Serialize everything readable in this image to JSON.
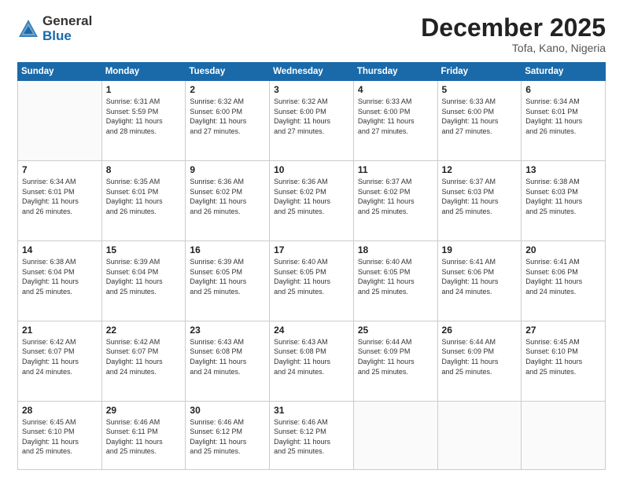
{
  "logo": {
    "general": "General",
    "blue": "Blue"
  },
  "header": {
    "month": "December 2025",
    "location": "Tofa, Kano, Nigeria"
  },
  "weekdays": [
    "Sunday",
    "Monday",
    "Tuesday",
    "Wednesday",
    "Thursday",
    "Friday",
    "Saturday"
  ],
  "weeks": [
    [
      {
        "day": "",
        "info": ""
      },
      {
        "day": "1",
        "info": "Sunrise: 6:31 AM\nSunset: 5:59 PM\nDaylight: 11 hours\nand 28 minutes."
      },
      {
        "day": "2",
        "info": "Sunrise: 6:32 AM\nSunset: 6:00 PM\nDaylight: 11 hours\nand 27 minutes."
      },
      {
        "day": "3",
        "info": "Sunrise: 6:32 AM\nSunset: 6:00 PM\nDaylight: 11 hours\nand 27 minutes."
      },
      {
        "day": "4",
        "info": "Sunrise: 6:33 AM\nSunset: 6:00 PM\nDaylight: 11 hours\nand 27 minutes."
      },
      {
        "day": "5",
        "info": "Sunrise: 6:33 AM\nSunset: 6:00 PM\nDaylight: 11 hours\nand 27 minutes."
      },
      {
        "day": "6",
        "info": "Sunrise: 6:34 AM\nSunset: 6:01 PM\nDaylight: 11 hours\nand 26 minutes."
      }
    ],
    [
      {
        "day": "7",
        "info": "Sunrise: 6:34 AM\nSunset: 6:01 PM\nDaylight: 11 hours\nand 26 minutes."
      },
      {
        "day": "8",
        "info": "Sunrise: 6:35 AM\nSunset: 6:01 PM\nDaylight: 11 hours\nand 26 minutes."
      },
      {
        "day": "9",
        "info": "Sunrise: 6:36 AM\nSunset: 6:02 PM\nDaylight: 11 hours\nand 26 minutes."
      },
      {
        "day": "10",
        "info": "Sunrise: 6:36 AM\nSunset: 6:02 PM\nDaylight: 11 hours\nand 25 minutes."
      },
      {
        "day": "11",
        "info": "Sunrise: 6:37 AM\nSunset: 6:02 PM\nDaylight: 11 hours\nand 25 minutes."
      },
      {
        "day": "12",
        "info": "Sunrise: 6:37 AM\nSunset: 6:03 PM\nDaylight: 11 hours\nand 25 minutes."
      },
      {
        "day": "13",
        "info": "Sunrise: 6:38 AM\nSunset: 6:03 PM\nDaylight: 11 hours\nand 25 minutes."
      }
    ],
    [
      {
        "day": "14",
        "info": "Sunrise: 6:38 AM\nSunset: 6:04 PM\nDaylight: 11 hours\nand 25 minutes."
      },
      {
        "day": "15",
        "info": "Sunrise: 6:39 AM\nSunset: 6:04 PM\nDaylight: 11 hours\nand 25 minutes."
      },
      {
        "day": "16",
        "info": "Sunrise: 6:39 AM\nSunset: 6:05 PM\nDaylight: 11 hours\nand 25 minutes."
      },
      {
        "day": "17",
        "info": "Sunrise: 6:40 AM\nSunset: 6:05 PM\nDaylight: 11 hours\nand 25 minutes."
      },
      {
        "day": "18",
        "info": "Sunrise: 6:40 AM\nSunset: 6:05 PM\nDaylight: 11 hours\nand 25 minutes."
      },
      {
        "day": "19",
        "info": "Sunrise: 6:41 AM\nSunset: 6:06 PM\nDaylight: 11 hours\nand 24 minutes."
      },
      {
        "day": "20",
        "info": "Sunrise: 6:41 AM\nSunset: 6:06 PM\nDaylight: 11 hours\nand 24 minutes."
      }
    ],
    [
      {
        "day": "21",
        "info": "Sunrise: 6:42 AM\nSunset: 6:07 PM\nDaylight: 11 hours\nand 24 minutes."
      },
      {
        "day": "22",
        "info": "Sunrise: 6:42 AM\nSunset: 6:07 PM\nDaylight: 11 hours\nand 24 minutes."
      },
      {
        "day": "23",
        "info": "Sunrise: 6:43 AM\nSunset: 6:08 PM\nDaylight: 11 hours\nand 24 minutes."
      },
      {
        "day": "24",
        "info": "Sunrise: 6:43 AM\nSunset: 6:08 PM\nDaylight: 11 hours\nand 24 minutes."
      },
      {
        "day": "25",
        "info": "Sunrise: 6:44 AM\nSunset: 6:09 PM\nDaylight: 11 hours\nand 25 minutes."
      },
      {
        "day": "26",
        "info": "Sunrise: 6:44 AM\nSunset: 6:09 PM\nDaylight: 11 hours\nand 25 minutes."
      },
      {
        "day": "27",
        "info": "Sunrise: 6:45 AM\nSunset: 6:10 PM\nDaylight: 11 hours\nand 25 minutes."
      }
    ],
    [
      {
        "day": "28",
        "info": "Sunrise: 6:45 AM\nSunset: 6:10 PM\nDaylight: 11 hours\nand 25 minutes."
      },
      {
        "day": "29",
        "info": "Sunrise: 6:46 AM\nSunset: 6:11 PM\nDaylight: 11 hours\nand 25 minutes."
      },
      {
        "day": "30",
        "info": "Sunrise: 6:46 AM\nSunset: 6:12 PM\nDaylight: 11 hours\nand 25 minutes."
      },
      {
        "day": "31",
        "info": "Sunrise: 6:46 AM\nSunset: 6:12 PM\nDaylight: 11 hours\nand 25 minutes."
      },
      {
        "day": "",
        "info": ""
      },
      {
        "day": "",
        "info": ""
      },
      {
        "day": "",
        "info": ""
      }
    ]
  ]
}
